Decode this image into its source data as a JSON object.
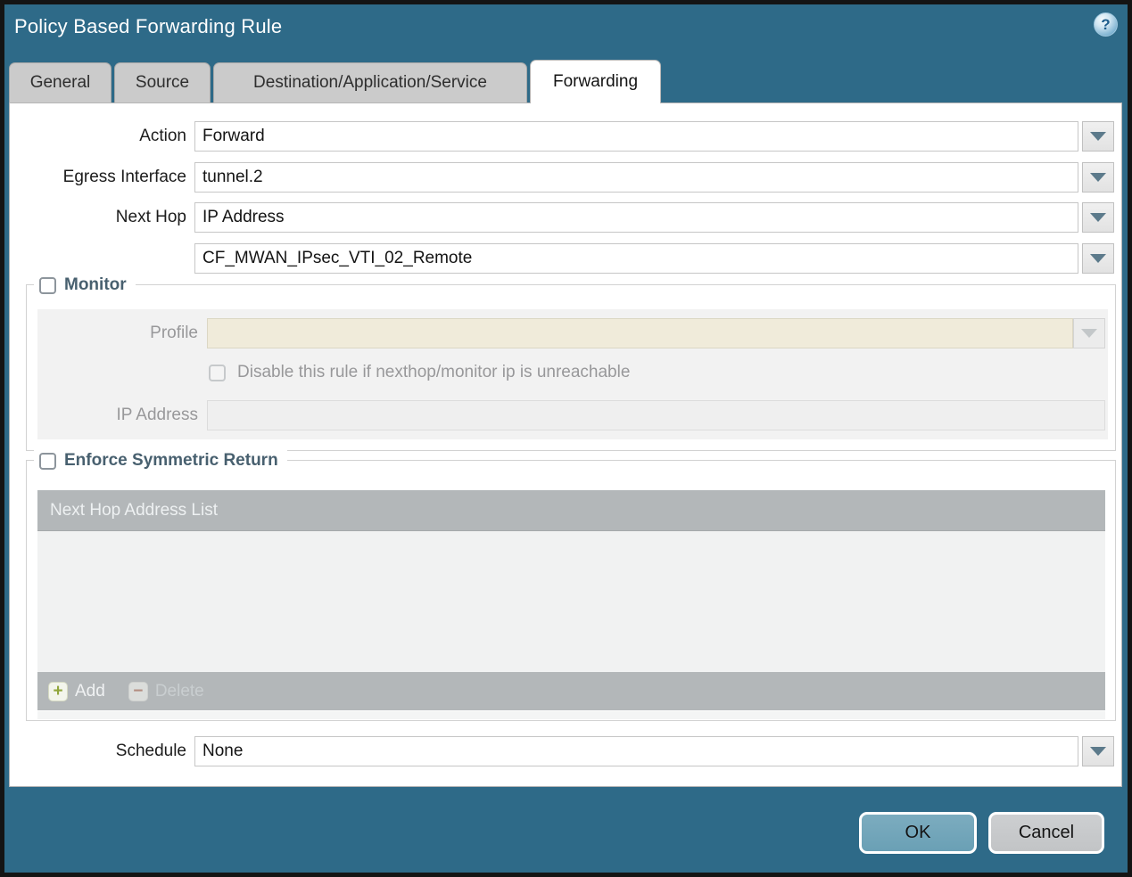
{
  "dialog": {
    "title": "Policy Based Forwarding Rule",
    "help_icon_glyph": "?",
    "tabs": [
      {
        "label": "General",
        "active": false
      },
      {
        "label": "Source",
        "active": false
      },
      {
        "label": "Destination/Application/Service",
        "active": false
      },
      {
        "label": "Forwarding",
        "active": true
      }
    ],
    "form": {
      "action": {
        "label": "Action",
        "value": "Forward"
      },
      "egress_interface": {
        "label": "Egress Interface",
        "value": "tunnel.2"
      },
      "next_hop": {
        "label": "Next Hop",
        "value": "IP Address"
      },
      "next_hop_address": {
        "value": "CF_MWAN_IPsec_VTI_02_Remote"
      },
      "monitor": {
        "legend": "Monitor",
        "checked": false,
        "profile_label": "Profile",
        "profile_value": "",
        "disable_checkbox_label": "Disable this rule if nexthop/monitor ip is unreachable",
        "disable_checkbox_checked": false,
        "ip_address_label": "IP Address",
        "ip_address_value": ""
      },
      "enforce_symmetric_return": {
        "legend": "Enforce Symmetric Return",
        "checked": false,
        "table_header": "Next Hop Address List",
        "rows": [],
        "add_label": "Add",
        "delete_label": "Delete",
        "add_icon_glyph": "+",
        "delete_icon_glyph": "−"
      },
      "schedule": {
        "label": "Schedule",
        "value": "None"
      }
    },
    "footer": {
      "ok_label": "OK",
      "cancel_label": "Cancel"
    },
    "colors": {
      "titlebar_bg": "#2e6a88",
      "tab_inactive_bg": "#cbcbcb",
      "tab_active_bg": "#ffffff",
      "disabled_profile_field_bg": "#f0ebda",
      "monitor_panel_bg": "#f2f2f2",
      "table_chrome_bg": "#b3b7b9",
      "table_body_bg": "#f1f2f2",
      "legend_text": "#48606f",
      "dropdown_arrow": "#5c7a8b",
      "ok_button_bg": "#72a7bb",
      "cancel_button_bg": "#c7c9cb",
      "add_plus": "#91a63c",
      "delete_minus": "#b3806f"
    }
  }
}
